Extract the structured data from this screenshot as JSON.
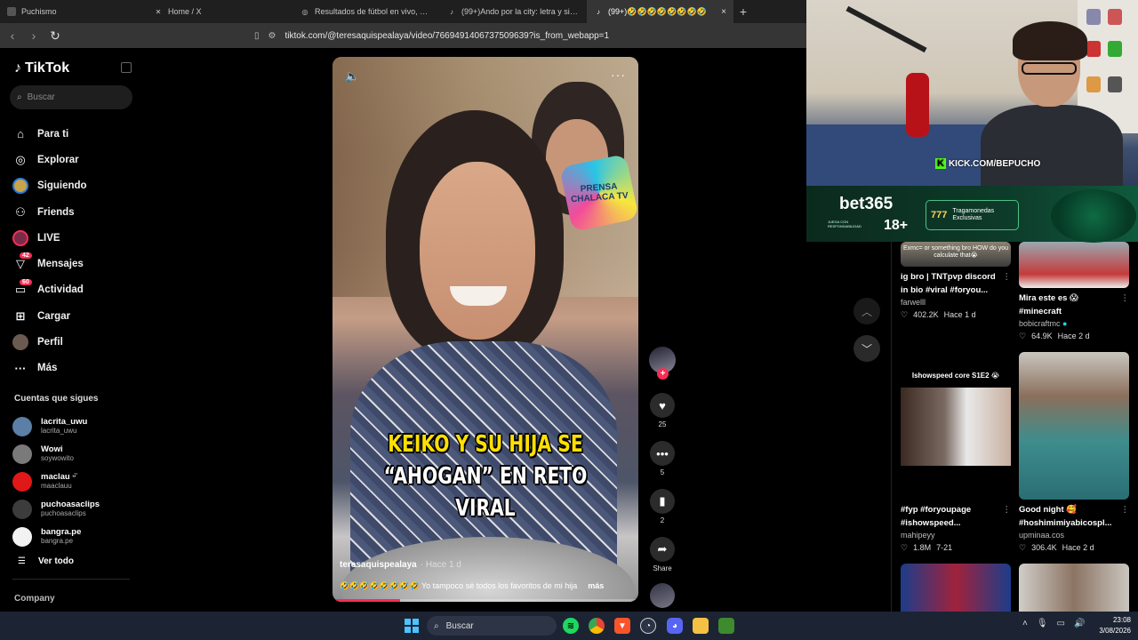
{
  "browser": {
    "tabs": [
      {
        "title": "Puchismo",
        "icon": "generic-page-icon",
        "active": false
      },
      {
        "title": "Home / X",
        "icon": "x-logo-icon",
        "active": false
      },
      {
        "title": "Resultados de fútbol en vivo, Marcad",
        "icon": "globe-icon",
        "active": false
      },
      {
        "title": "(99+)Ando por la city: letra y significa",
        "icon": "tiktok-icon",
        "active": false
      },
      {
        "title": "(99+)🤣🤣🤣🤣🤣🤣🤣🤣",
        "icon": "tiktok-icon",
        "active": true
      }
    ],
    "new_tab": "+",
    "close": "×",
    "url": "tiktok.com/@teresaquispealaya/video/7669491406737509639?is_from_webapp=1"
  },
  "sidebar": {
    "brand": "TikTok",
    "search_placeholder": "Buscar",
    "menu": [
      {
        "label": "Para ti",
        "icon": "home-icon"
      },
      {
        "label": "Explorar",
        "icon": "compass-icon"
      },
      {
        "label": "Siguiendo",
        "icon": "following-icon"
      },
      {
        "label": "Friends",
        "icon": "friends-icon"
      },
      {
        "label": "LIVE",
        "icon": "live-icon"
      },
      {
        "label": "Mensajes",
        "icon": "messages-icon",
        "badge": "42"
      },
      {
        "label": "Actividad",
        "icon": "activity-icon",
        "badge": "60"
      },
      {
        "label": "Cargar",
        "icon": "upload-icon"
      },
      {
        "label": "Perfil",
        "icon": "profile-icon"
      },
      {
        "label": "Más",
        "icon": "more-icon"
      }
    ],
    "following_header": "Cuentas que sigues",
    "following": [
      {
        "name": "lacrita_uwu",
        "handle": "lacrita_uwu",
        "color": "#5b7fa6"
      },
      {
        "name": "Wowi",
        "handle": "soywowito",
        "color": "#7a7a7a"
      },
      {
        "name": "maclau ᵕ̈",
        "handle": "maaclauu",
        "color": "#e01818"
      },
      {
        "name": "puchoasaclips",
        "handle": "puchoasaclips",
        "color": "#3c3c3c"
      },
      {
        "name": "bangra.pe",
        "handle": "bangra.pe",
        "color": "#f2f2f2"
      }
    ],
    "see_all": "Ver todo",
    "company": "Company"
  },
  "video": {
    "caption_line1": "KEIKO Y SU HIJA SE",
    "caption_line2": "“AHOGAN” EN RETO VIRAL",
    "badge_text": "PRENSA CHALACA TV",
    "author": "teresaquispealaya",
    "posted": "· Hace 1 d",
    "description": "🤣🤣🤣🤣🤣🤣🤣🤣 Yo tampoco sé  todos los favoritos de mi hija",
    "more": "más",
    "progress": 0.22
  },
  "actions": {
    "likes": "25",
    "comments": "5",
    "saves": "2",
    "share": "Share"
  },
  "stream": {
    "kick_label": "KICK.COM/BEPUCHO",
    "bet_brand": "bet365",
    "bet_age": "18+",
    "bet_fine": "JUEGA CON RESPONSABILIDAD",
    "bet_chip": "Tragamonedas Exclusivas",
    "bet_slot": "777"
  },
  "recommendations": [
    {
      "title": "ig bro | TNTpvp discord in bio #viral #foryou...",
      "author": "farwelll",
      "likes": "402.2K",
      "time": "Hace 1 d",
      "overlay": "Exmc= or something bro HOW do you calculate that😭"
    },
    {
      "title": "Mira este es 😱 #minecraft",
      "author": "bobicraftmc",
      "likes": "64.9K",
      "time": "Hace 2 d",
      "overlay": ""
    },
    {
      "title": "#fyp #foryoupage #ishowspeed...",
      "author": "mahipeyy",
      "likes": "1.8M",
      "time": "7-21",
      "overlay": "Ishowspeed core S1E2 😭"
    },
    {
      "title": "Good night 🥰 #hoshimimiyabicospl...",
      "author": "upminaa.cos",
      "likes": "306.4K",
      "time": "Hace 2 d",
      "overlay": ""
    }
  ],
  "taskbar": {
    "search_placeholder": "Buscar",
    "time": "23:08",
    "date": "3/08/2026"
  }
}
